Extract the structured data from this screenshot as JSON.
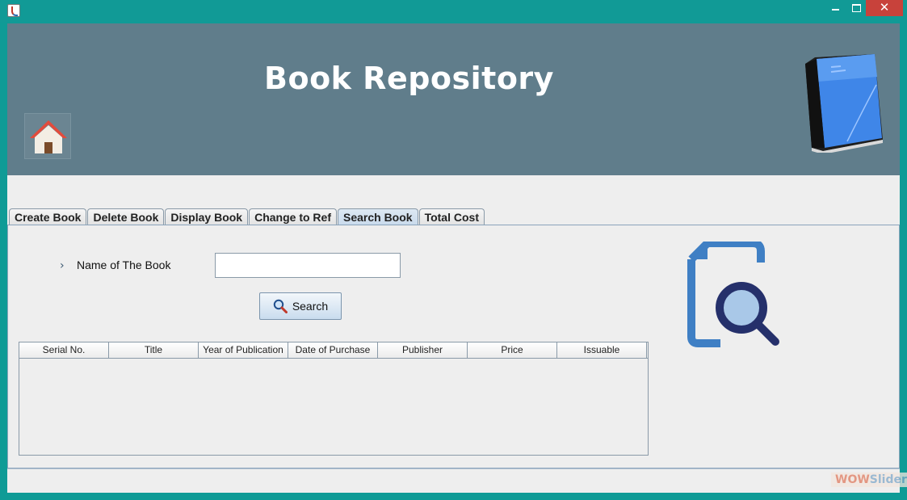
{
  "window": {
    "close_glyph": "✕"
  },
  "header": {
    "title": "Book Repository"
  },
  "tabs": [
    {
      "label": "Create Book"
    },
    {
      "label": "Delete Book"
    },
    {
      "label": "Display Book"
    },
    {
      "label": "Change to Ref"
    },
    {
      "label": "Search Book",
      "active": true
    },
    {
      "label": "Total Cost"
    }
  ],
  "search": {
    "chevron": "›",
    "field_label": "Name of The Book",
    "input_value": "",
    "button_label": "Search"
  },
  "table": {
    "columns": [
      "Serial No.",
      "Title",
      "Year of Publication",
      "Date of Purchase",
      "Publisher",
      "Price",
      "Issuable"
    ],
    "rows": []
  },
  "watermark": {
    "part1": "WOW",
    "part2": "Slider"
  },
  "colors": {
    "window_frame": "#0f9b96",
    "header_bg": "#607d8b",
    "close_button": "#c8423b",
    "active_tab": "#c7d9eb",
    "search_icon_blue": "#3f7fc4",
    "magnifier_navy": "#25306b"
  }
}
